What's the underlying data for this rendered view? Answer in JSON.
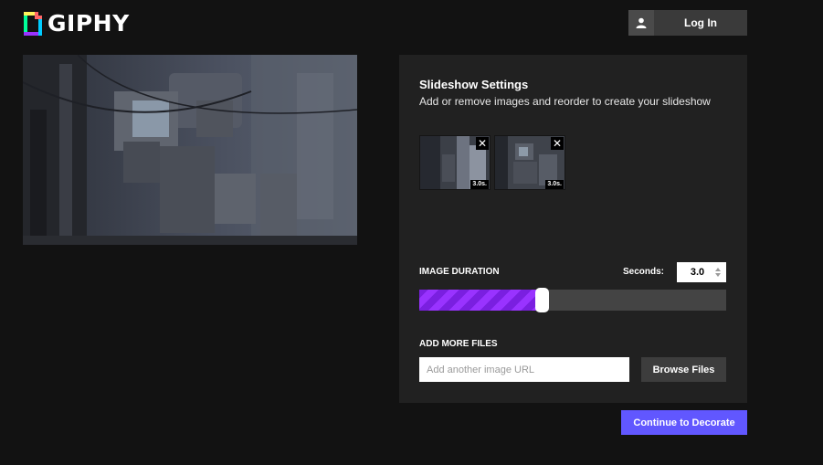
{
  "brand": {
    "name": "GIPHY"
  },
  "header": {
    "login_label": "Log In",
    "login_icon": "user-icon"
  },
  "settings": {
    "title": "Slideshow Settings",
    "subtitle": "Add or remove images and reorder to create your slideshow",
    "thumbnails": [
      {
        "duration_label": "3.0s.",
        "remove_icon": "close-icon"
      },
      {
        "duration_label": "3.0s.",
        "remove_icon": "close-icon"
      }
    ],
    "image_duration_label": "IMAGE DURATION",
    "seconds_label": "Seconds:",
    "seconds_value": "3.0",
    "duration_slider_fraction": 0.4,
    "add_more_files_label": "ADD MORE FILES",
    "url_placeholder": "Add another image URL",
    "browse_label": "Browse Files"
  },
  "actions": {
    "continue_label": "Continue to Decorate"
  },
  "colors": {
    "background": "#121212",
    "panel": "#212121",
    "accent_purple": "#9933ff",
    "continue_button": "#6157ff"
  }
}
